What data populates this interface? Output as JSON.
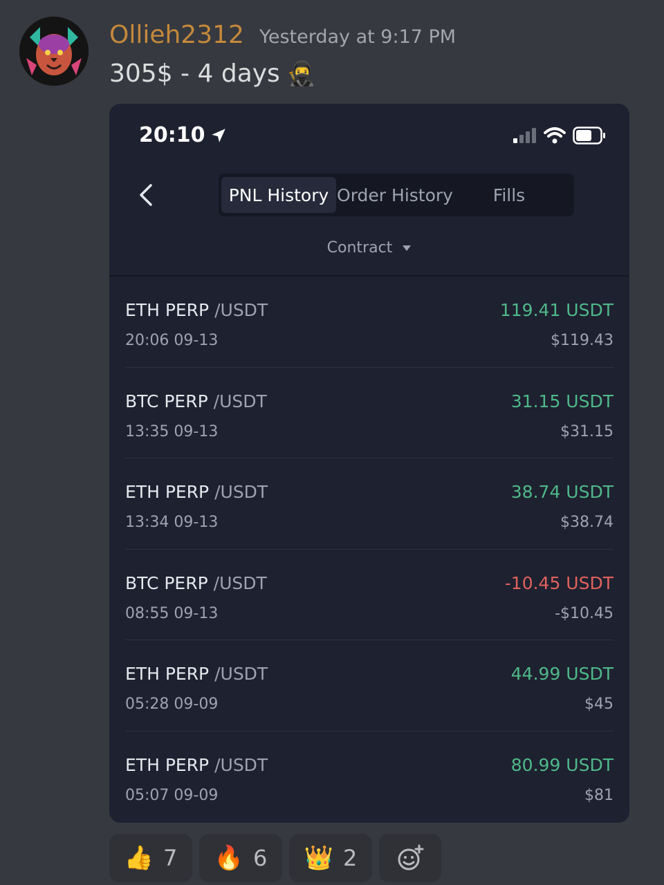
{
  "message": {
    "username": "Ollieh2312",
    "timestamp": "Yesterday at 9:17 PM",
    "text": "305$ - 4 days",
    "text_emoji": "🥷"
  },
  "phone": {
    "status_time": "20:10",
    "tabs": [
      {
        "label": "PNL History",
        "active": true
      },
      {
        "label": "Order History",
        "active": false
      },
      {
        "label": "Fills",
        "active": false
      }
    ],
    "filter_label": "Contract",
    "rows": [
      {
        "symbol": "ETH PERP",
        "quote": "/USDT",
        "time": "20:06 09-13",
        "pnl": "119.41 USDT",
        "usd": "$119.43",
        "positive": true
      },
      {
        "symbol": "BTC PERP",
        "quote": "/USDT",
        "time": "13:35 09-13",
        "pnl": "31.15 USDT",
        "usd": "$31.15",
        "positive": true
      },
      {
        "symbol": "ETH PERP",
        "quote": "/USDT",
        "time": "13:34 09-13",
        "pnl": "38.74 USDT",
        "usd": "$38.74",
        "positive": true
      },
      {
        "symbol": "BTC PERP",
        "quote": "/USDT",
        "time": "08:55 09-13",
        "pnl": "-10.45 USDT",
        "usd": "-$10.45",
        "positive": false
      },
      {
        "symbol": "ETH PERP",
        "quote": "/USDT",
        "time": "05:28 09-09",
        "pnl": "44.99 USDT",
        "usd": "$45",
        "positive": true
      },
      {
        "symbol": "ETH PERP",
        "quote": "/USDT",
        "time": "05:07 09-09",
        "pnl": "80.99 USDT",
        "usd": "$81",
        "positive": true
      }
    ],
    "colors": {
      "positive": "#4fb989",
      "negative": "#e0625d"
    }
  },
  "reactions": [
    {
      "emoji": "👍",
      "count": "7"
    },
    {
      "emoji": "🔥",
      "count": "6"
    },
    {
      "emoji": "👑",
      "count": "2"
    }
  ]
}
